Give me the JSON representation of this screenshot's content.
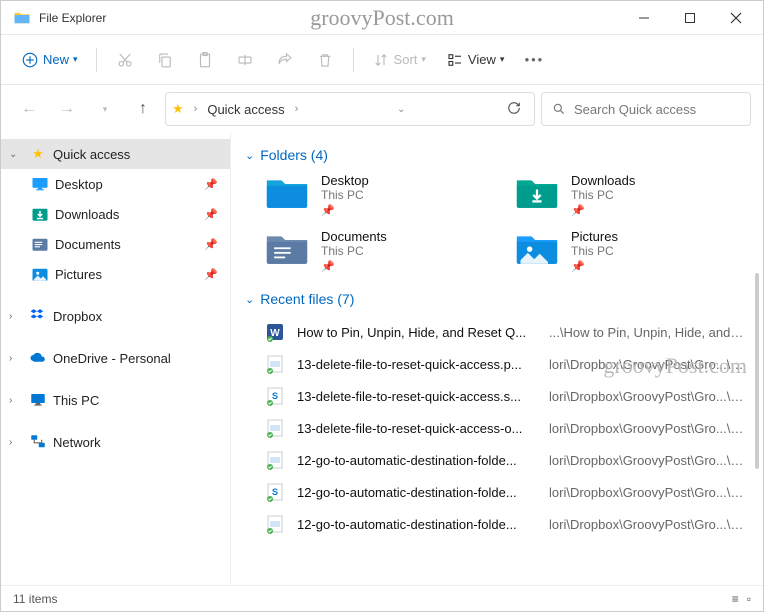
{
  "window": {
    "title": "File Explorer",
    "watermark": "groovyPost.com"
  },
  "toolbar": {
    "new": "New",
    "sort": "Sort",
    "view": "View"
  },
  "address": {
    "location": "Quick access"
  },
  "search": {
    "placeholder": "Search Quick access"
  },
  "sidebar": {
    "quickaccess": "Quick access",
    "qa_items": [
      {
        "label": "Desktop",
        "icon": "desktop"
      },
      {
        "label": "Downloads",
        "icon": "downloads"
      },
      {
        "label": "Documents",
        "icon": "documents"
      },
      {
        "label": "Pictures",
        "icon": "pictures"
      }
    ],
    "roots": [
      {
        "label": "Dropbox",
        "icon": "dropbox"
      },
      {
        "label": "OneDrive - Personal",
        "icon": "onedrive"
      },
      {
        "label": "This PC",
        "icon": "thispc"
      },
      {
        "label": "Network",
        "icon": "network"
      }
    ]
  },
  "main": {
    "folders_header": "Folders (4)",
    "folders": [
      {
        "name": "Desktop",
        "sub": "This PC",
        "icon": "desktop"
      },
      {
        "name": "Downloads",
        "sub": "This PC",
        "icon": "downloads"
      },
      {
        "name": "Documents",
        "sub": "This PC",
        "icon": "documents"
      },
      {
        "name": "Pictures",
        "sub": "This PC",
        "icon": "pictures"
      }
    ],
    "recent_header": "Recent files (7)",
    "recent": [
      {
        "name": "How to Pin, Unpin, Hide, and Reset Q...",
        "path": "...\\How to Pin, Unpin, Hide, and Reset ...",
        "type": "word"
      },
      {
        "name": "13-delete-file-to-reset-quick-access.p...",
        "path": "lori\\Dropbox\\GroovyPost\\Gro...\\images",
        "type": "img"
      },
      {
        "name": "13-delete-file-to-reset-quick-access.s...",
        "path": "lori\\Dropbox\\GroovyPost\\Gro...\\images",
        "type": "snag"
      },
      {
        "name": "13-delete-file-to-reset-quick-access-o...",
        "path": "lori\\Dropbox\\GroovyPost\\Gro...\\images",
        "type": "img"
      },
      {
        "name": "12-go-to-automatic-destination-folde...",
        "path": "lori\\Dropbox\\GroovyPost\\Gro...\\images",
        "type": "img"
      },
      {
        "name": "12-go-to-automatic-destination-folde...",
        "path": "lori\\Dropbox\\GroovyPost\\Gro...\\images",
        "type": "snag"
      },
      {
        "name": "12-go-to-automatic-destination-folde...",
        "path": "lori\\Dropbox\\GroovyPost\\Gro...\\images",
        "type": "img"
      }
    ]
  },
  "status": {
    "items": "11 items"
  }
}
